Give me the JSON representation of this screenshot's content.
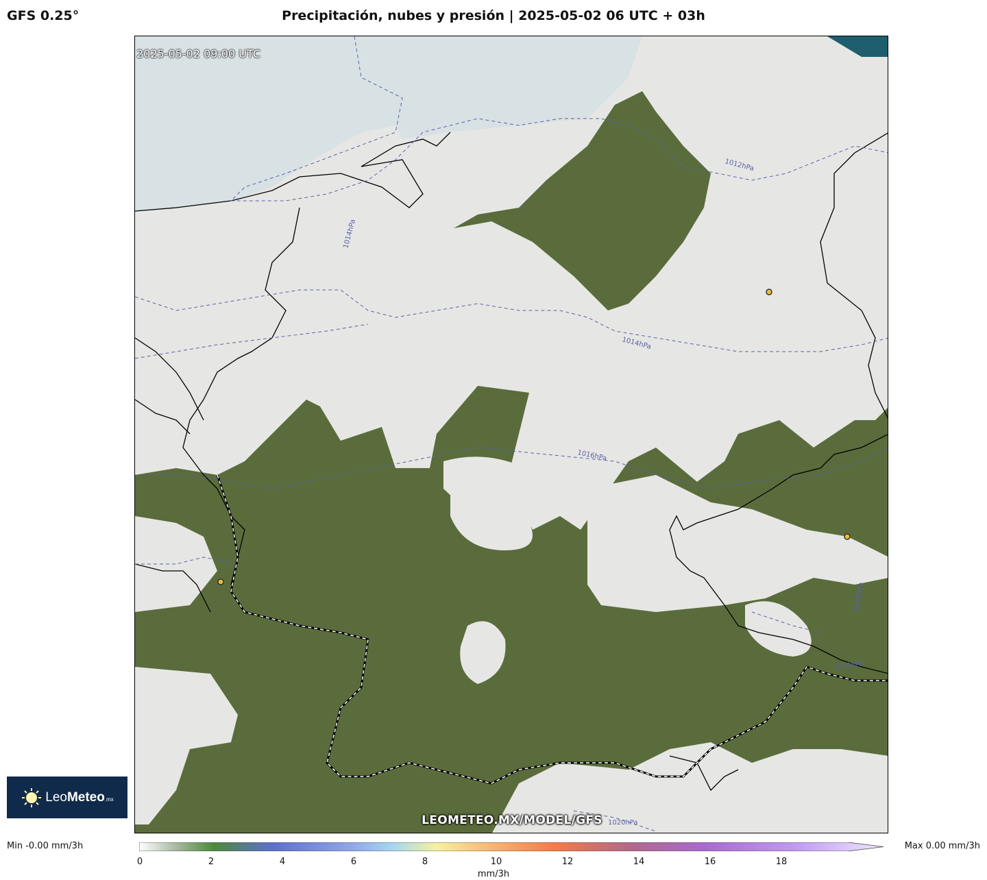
{
  "header": {
    "model": "GFS 0.25°",
    "title": "Precipitación, nubes y presión | 2025-05-02 06 UTC + 03h"
  },
  "map": {
    "timestamp": "2025-05-02 09:00 UTC",
    "watermark": "LEOMETEO.MX/MODEL/GFS",
    "isobars": [
      "1012hPa",
      "1014hPa",
      "1014hPa",
      "1016hPa",
      "1018hPa",
      "1018hPa",
      "1020hPa"
    ],
    "colors": {
      "water": "#dbe3e6",
      "cloud": "#e4e5e2",
      "land": "#5a6a3a",
      "isobar": "#5b5fa8"
    }
  },
  "logo": {
    "brand_light": "Leo",
    "brand_bold": "Meteo",
    "suffix": ".mx",
    "icon": "sun-icon"
  },
  "legend": {
    "min": "Min -0.00 mm/3h",
    "max": "Max 0.00 mm/3h",
    "unit": "mm/3h",
    "ticks": [
      "0",
      "2",
      "4",
      "6",
      "8",
      "10",
      "12",
      "14",
      "16",
      "18"
    ],
    "range": [
      0,
      20
    ]
  }
}
